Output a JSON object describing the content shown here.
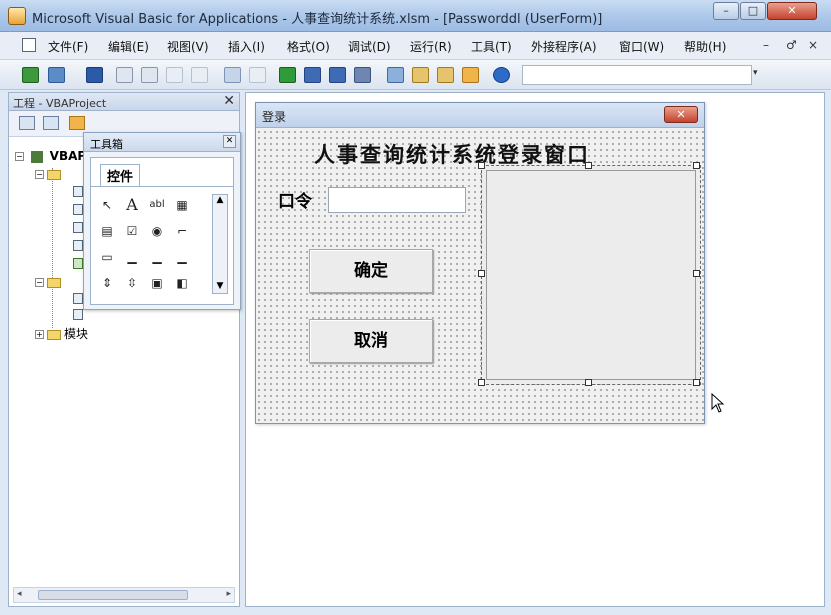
{
  "window": {
    "title": "Microsoft Visual Basic for Applications - 人事查询统计系统.xlsm - [Passworddl (UserForm)]",
    "controls": {
      "minimize": "–",
      "maximize": "□",
      "close": "✕"
    }
  },
  "menu": {
    "items": [
      "文件(F)",
      "编辑(E)",
      "视图(V)",
      "插入(I)",
      "格式(O)",
      "调试(D)",
      "运行(R)",
      "工具(T)",
      "外接程序(A)",
      "窗口(W)",
      "帮助(H)"
    ],
    "mdi_controls": [
      "–",
      "♂",
      "×"
    ]
  },
  "project_pane": {
    "title": "工程 - VBAProject",
    "close": "✕",
    "root_label": "VBAP",
    "modules_folder": "模块"
  },
  "toolbox": {
    "title": "工具箱",
    "close": "✕",
    "tab": "控件",
    "controls": [
      {
        "icon": "pointer-icon",
        "glyph": "↖"
      },
      {
        "icon": "label-icon",
        "glyph": "A"
      },
      {
        "icon": "textbox-icon",
        "glyph": "abl"
      },
      {
        "icon": "combobox-icon",
        "glyph": "▦"
      },
      {
        "icon": "listbox-icon",
        "glyph": "▤"
      },
      {
        "icon": "checkbox-icon",
        "glyph": "☑"
      },
      {
        "icon": "optionbutton-icon",
        "glyph": "◉"
      },
      {
        "icon": "togglebutton-icon",
        "glyph": "⌐"
      },
      {
        "icon": "frame-icon",
        "glyph": "▭"
      },
      {
        "icon": "commandbutton-icon",
        "glyph": "▁"
      },
      {
        "icon": "tabstrip-icon",
        "glyph": "▁"
      },
      {
        "icon": "multipage-icon",
        "glyph": "▁"
      },
      {
        "icon": "scrollbar-icon",
        "glyph": "⇕"
      },
      {
        "icon": "spinbutton-icon",
        "glyph": "⇳"
      },
      {
        "icon": "image-icon",
        "glyph": "▣"
      },
      {
        "icon": "refedit-icon",
        "glyph": "◧"
      }
    ],
    "scroll_up": "▲",
    "scroll_down": "▼"
  },
  "userform": {
    "title": "登录",
    "close": "✕",
    "heading": "人事查询统计系统登录窗口",
    "password_label": "口令",
    "password_value": "",
    "ok_button": "确定",
    "cancel_button": "取消"
  },
  "colors": {
    "title_bar": "#a9c5e8",
    "close_button": "#c5432c",
    "form_background": "#f0f0f0"
  }
}
